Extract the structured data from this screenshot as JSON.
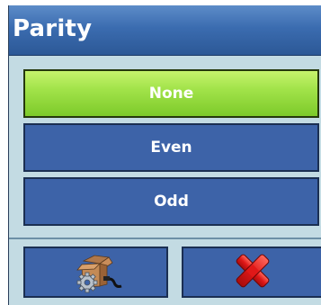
{
  "dialog": {
    "title": "Parity"
  },
  "options": [
    {
      "label": "None",
      "selected": true
    },
    {
      "label": "Even",
      "selected": false
    },
    {
      "label": "Odd",
      "selected": false
    }
  ],
  "actions": {
    "setup_icon": "box-with-gear-icon",
    "cancel_icon": "red-x-icon"
  },
  "colors": {
    "title_bar": "#3b6cb0",
    "selected_option": "#a2e34a",
    "option_button": "#3d63a8",
    "dialog_background": "#c3dbe3",
    "cancel_x": "#e01818"
  }
}
